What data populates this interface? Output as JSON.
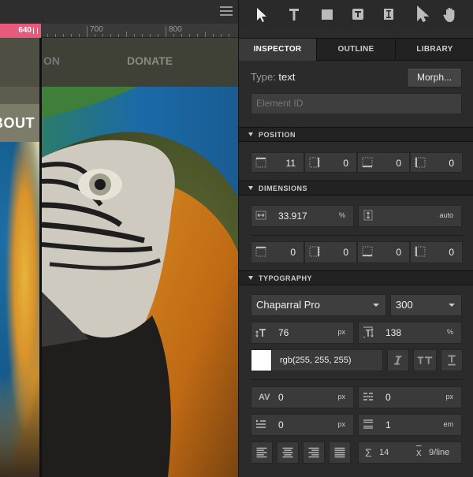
{
  "canvas": {
    "breakpoint_label": "640",
    "ruler_labels": [
      "700",
      "800"
    ],
    "nav_partial": "ON",
    "nav_donate": "DONATE",
    "about_partial": "BOUT"
  },
  "toolbar": {
    "tools": [
      "select-arrow-icon",
      "text-tool-icon",
      "box-tool-icon",
      "text-box-tool-icon",
      "text-cursor-tool-icon",
      "direct-select-icon",
      "hand-icon"
    ]
  },
  "tabs": [
    "INSPECTOR",
    "OUTLINE",
    "LIBRARY"
  ],
  "inspector": {
    "type_label": "Type:",
    "type_value": "text",
    "morph_label": "Morph...",
    "element_id_placeholder": "Element ID"
  },
  "position": {
    "title": "POSITION",
    "top": "11",
    "right": "0",
    "bottom": "0",
    "left": "0"
  },
  "dimensions": {
    "title": "DIMENSIONS",
    "width_value": "33.917",
    "width_unit": "%",
    "height_value": "auto",
    "padding_top": "0",
    "padding_right": "0",
    "padding_bottom": "0",
    "padding_left": "0"
  },
  "typography": {
    "title": "TYPOGRAPHY",
    "font_family": "Chaparral Pro",
    "font_weight": "300",
    "font_size": "76",
    "font_size_unit": "px",
    "line_height": "138",
    "line_height_unit": "%",
    "color_value": "rgb(255, 255, 255)",
    "color_swatch": "#ffffff",
    "letter_spacing": "0",
    "letter_spacing_unit": "px",
    "word_spacing": "0",
    "word_spacing_unit": "px",
    "indent": "0",
    "indent_unit": "px",
    "margin": "1",
    "margin_unit": "em",
    "sum_value": "14",
    "avg_value": "9/line"
  }
}
